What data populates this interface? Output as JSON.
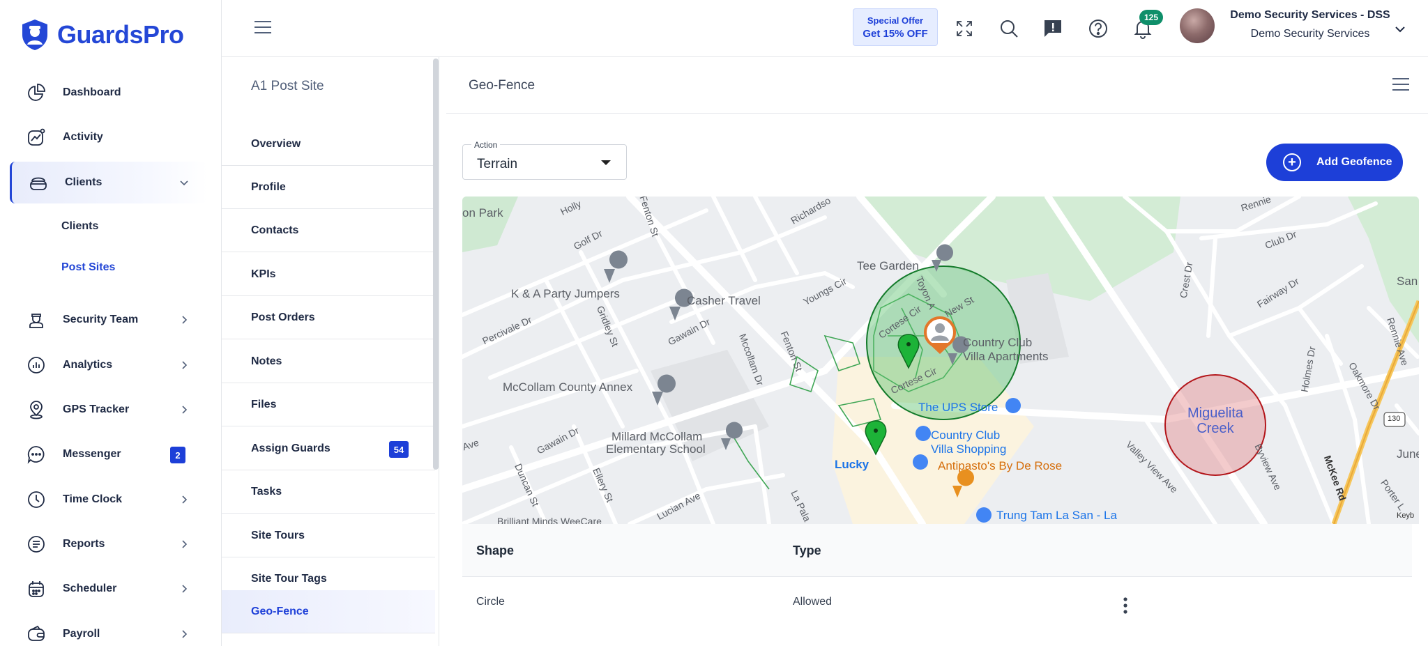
{
  "brand": {
    "name": "GuardsPro"
  },
  "sidebar": {
    "items": [
      {
        "label": "Dashboard",
        "icon": "pie-chart-icon"
      },
      {
        "label": "Activity",
        "icon": "activity-chart-icon"
      },
      {
        "label": "Clients",
        "icon": "clients-icon",
        "expanded": true,
        "children": [
          {
            "label": "Clients"
          },
          {
            "label": "Post Sites",
            "active": true
          }
        ]
      },
      {
        "label": "Security Team",
        "icon": "guard-icon"
      },
      {
        "label": "Analytics",
        "icon": "analytics-icon"
      },
      {
        "label": "GPS Tracker",
        "icon": "location-pin-icon"
      },
      {
        "label": "Messenger",
        "icon": "chat-icon",
        "badge": "2"
      },
      {
        "label": "Time Clock",
        "icon": "clock-icon"
      },
      {
        "label": "Reports",
        "icon": "report-icon"
      },
      {
        "label": "Scheduler",
        "icon": "calendar-icon"
      },
      {
        "label": "Payroll",
        "icon": "wallet-icon"
      }
    ]
  },
  "header": {
    "offer_line1": "Special Offer",
    "offer_line2": "Get 15% OFF",
    "notifications_count": "125",
    "user_name": "Demo Security Services - DSS",
    "user_org": "Demo Security Services"
  },
  "site_menu": {
    "title": "A1 Post Site",
    "items": [
      {
        "label": "Overview"
      },
      {
        "label": "Profile"
      },
      {
        "label": "Contacts"
      },
      {
        "label": "KPIs"
      },
      {
        "label": "Post Orders"
      },
      {
        "label": "Notes"
      },
      {
        "label": "Files"
      },
      {
        "label": "Assign Guards",
        "badge": "54"
      },
      {
        "label": "Tasks"
      },
      {
        "label": "Site Tours"
      },
      {
        "label": "Site Tour Tags"
      },
      {
        "label": "Geo-Fence",
        "active": true
      }
    ]
  },
  "main": {
    "title": "Geo-Fence",
    "action": {
      "label": "Action",
      "value": "Terrain"
    },
    "add_button": "Add Geofence",
    "map": {
      "labels": {
        "park": "on Park",
        "holly": "Holly",
        "golf": "Golf Dr",
        "fenton_st_top": "Fenton St",
        "richardson": "Richardso",
        "tee_garden": "Tee Garden",
        "rennie_top": "Rennie",
        "club_dr": "Club Dr",
        "san": "San",
        "k_a": "K & A Party Jumpers",
        "casher": "Casher Travel",
        "youngs": "Youngs Cir",
        "crest": "Crest Dr",
        "fairway": "Fairway Dr",
        "percivale": "Percivale Dr",
        "gridley": "Gridley St",
        "gawain_top": "Gawain Dr",
        "cortese_top": "Cortese Cir",
        "toyon": "Toyon A",
        "new_st": "New St",
        "country_club_villa": "Country Club",
        "villa_apts": "Villa Apartments",
        "mccollam_dr": "Mccollam Dr",
        "fenton_st": "Fenton St",
        "rennie_right": "Rennie Ave",
        "holmes": "Holmes Dr",
        "oakmore": "Oakmore Dr",
        "mccollam_annex": "McCollam County Annex",
        "cortese_bottom": "Cortese Cir",
        "ups": "The UPS Store",
        "miguelita": "Miguelita",
        "creek": "Creek",
        "route": "130",
        "ave": "Ave",
        "gawain_bottom": "Gawain Dr",
        "millard1": "Millard McCollam",
        "millard2": "Elementary School",
        "cc_shopping1": "Country Club",
        "cc_shopping2": "Villa Shopping",
        "lucky": "Lucky",
        "antipasto": "Antipasto's By De Rose",
        "valley_view": "Valley View Ave",
        "byview": "Byview Ave",
        "mckee": "McKee Rd",
        "june": "June",
        "duncan": "Duncan St",
        "ellery": "Ellery St",
        "lucian": "Lucian Ave",
        "la_pala": "La Pala",
        "porter": "Porter L",
        "brilliant": "Brilliant Minds WeeCare",
        "trung": "Trung Tam La San - La",
        "keyb": "Keyb"
      }
    },
    "table": {
      "columns": [
        "Shape",
        "Type"
      ],
      "rows": [
        {
          "shape": "Circle",
          "type": "Allowed"
        }
      ]
    }
  }
}
